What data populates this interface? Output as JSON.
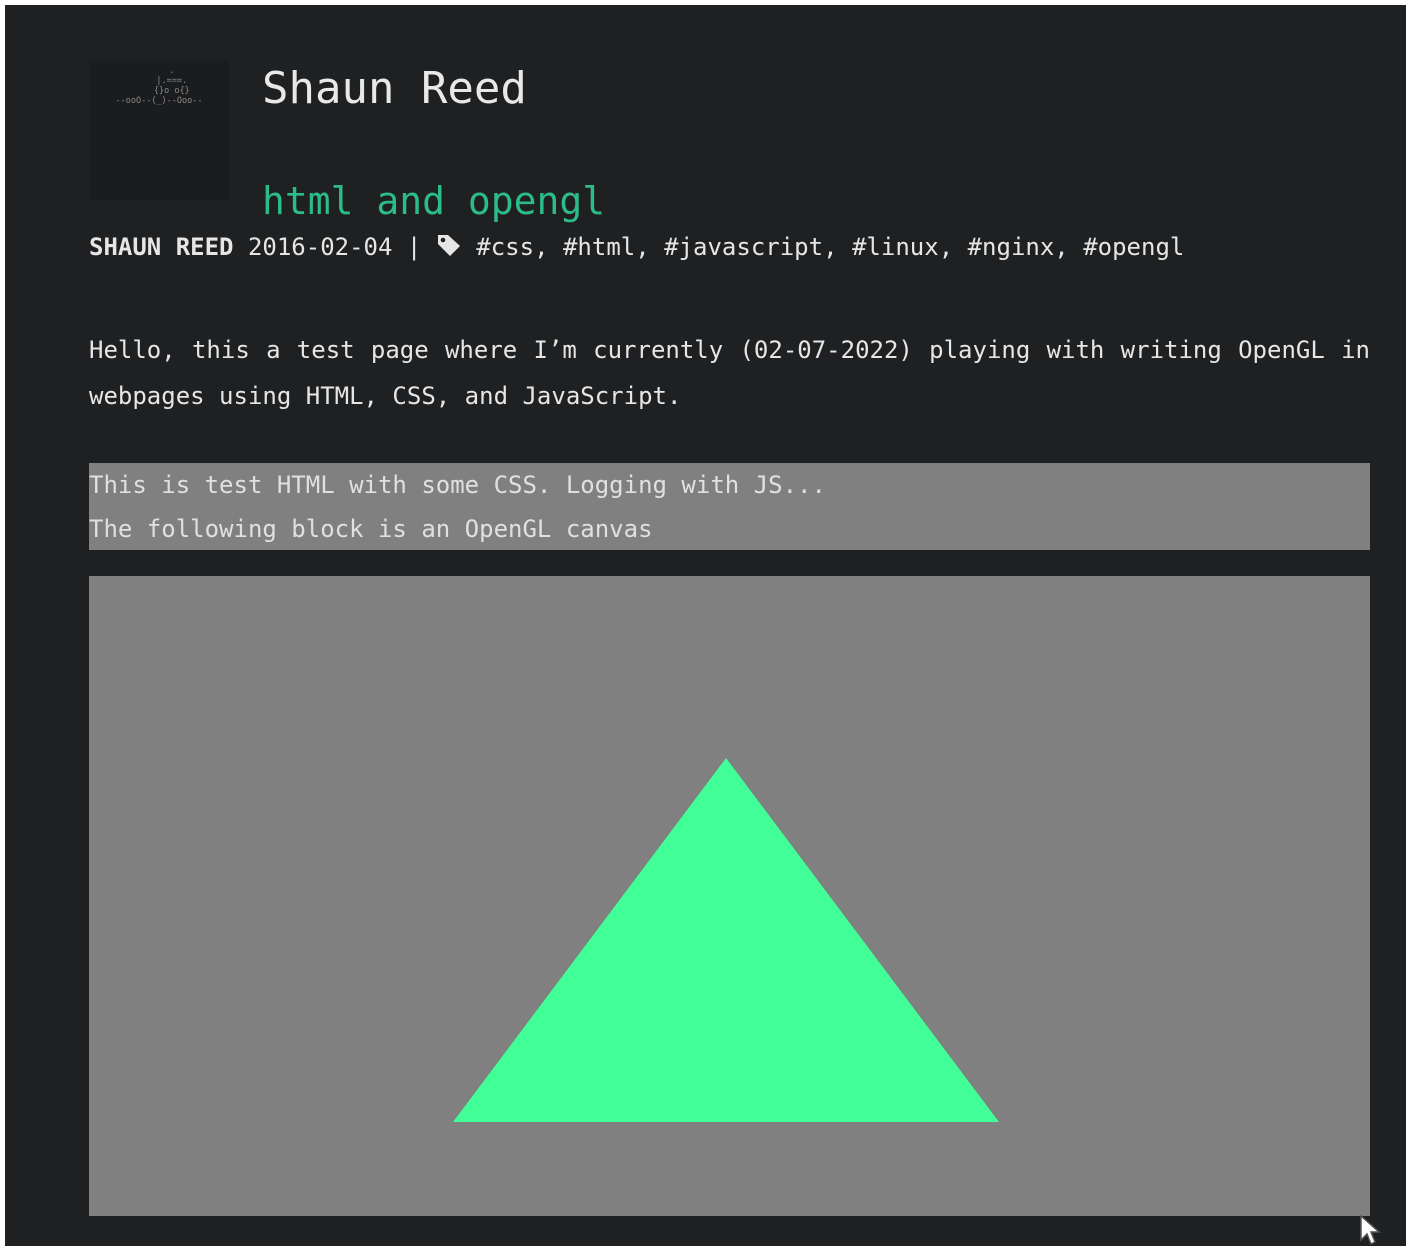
{
  "site": {
    "title": "Shaun Reed",
    "logo_ascii": "     .\n     |.===.\n     {}o o{}\n--ooO--(_)--Ooo--"
  },
  "post": {
    "title": "html and opengl",
    "author": "SHAUN REED",
    "date": "2016-02-04",
    "separator": "|",
    "tags": [
      "#css",
      "#html",
      "#javascript",
      "#linux",
      "#nginx",
      "#opengl"
    ],
    "intro": "Hello, this a test page where I’m currently (02-07-2022) playing with writing OpenGL in webpages using HTML, CSS, and JavaScript."
  },
  "log_box": {
    "lines": [
      "This is test HTML with some CSS. Logging with JS...",
      "The following block is an OpenGL canvas"
    ]
  },
  "canvas": {
    "background_color": "#808080",
    "triangle_color": "#41ff96"
  },
  "colors": {
    "page_bg": "#1f2022",
    "accent": "#2bbc8a",
    "text": "#e6e6e6"
  }
}
